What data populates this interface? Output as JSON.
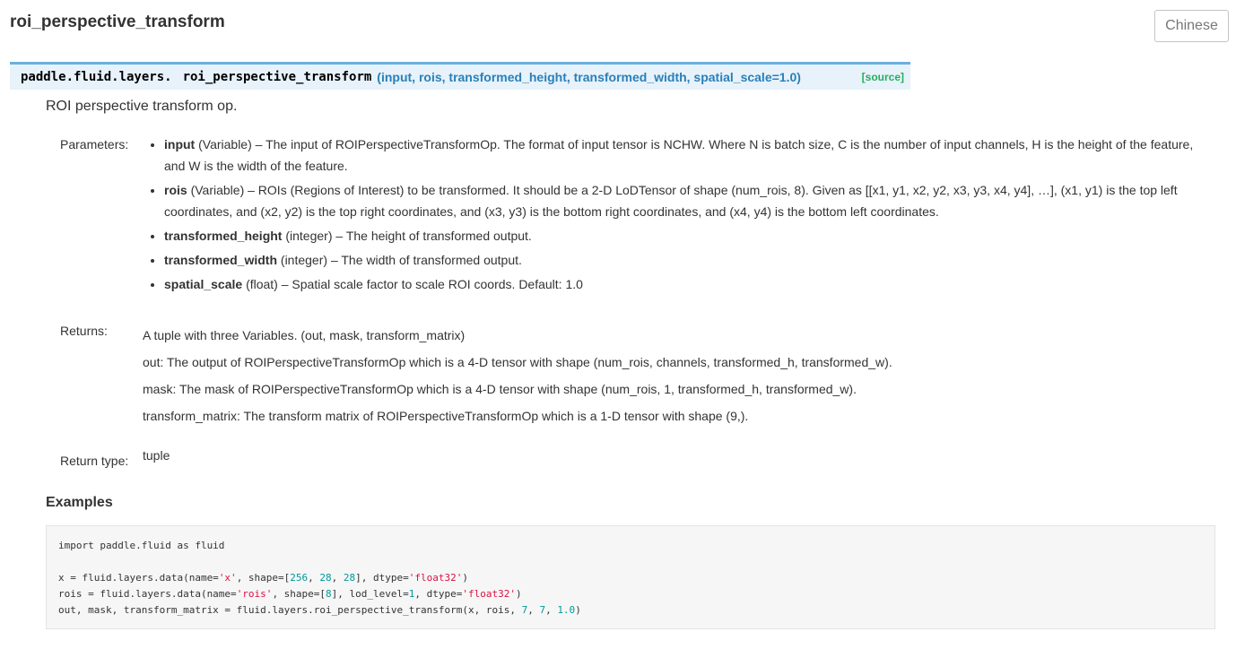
{
  "page": {
    "title": "roi_perspective_transform",
    "lang_button": "Chinese"
  },
  "signature": {
    "prefix": "paddle.fluid.layers.",
    "name": "roi_perspective_transform",
    "params": "(input, rois, transformed_height, transformed_width, spatial_scale=1.0)",
    "source": "[source]"
  },
  "description": "ROI perspective transform op.",
  "parameters": {
    "label": "Parameters:",
    "items": [
      {
        "name": "input",
        "type": "(Variable)",
        "desc": "– The input of ROIPerspectiveTransformOp. The format of input tensor is NCHW. Where N is batch size, C is the number of input channels, H is the height of the feature, and W is the width of the feature."
      },
      {
        "name": "rois",
        "type": "(Variable)",
        "desc": "– ROIs (Regions of Interest) to be transformed. It should be a 2-D LoDTensor of shape (num_rois, 8). Given as [[x1, y1, x2, y2, x3, y3, x4, y4], …], (x1, y1) is the top left coordinates, and (x2, y2) is the top right coordinates, and (x3, y3) is the bottom right coordinates, and (x4, y4) is the bottom left coordinates."
      },
      {
        "name": "transformed_height",
        "type": "(integer)",
        "desc": "– The height of transformed output."
      },
      {
        "name": "transformed_width",
        "type": "(integer)",
        "desc": "– The width of transformed output."
      },
      {
        "name": "spatial_scale",
        "type": "(float)",
        "desc": "– Spatial scale factor to scale ROI coords. Default: 1.0"
      }
    ]
  },
  "returns": {
    "label": "Returns:",
    "lines": [
      "A tuple with three Variables. (out, mask, transform_matrix)",
      "out: The output of ROIPerspectiveTransformOp which is a 4-D tensor with shape (num_rois, channels, transformed_h, transformed_w).",
      "mask: The mask of ROIPerspectiveTransformOp which is a 4-D tensor with shape (num_rois, 1, transformed_h, transformed_w).",
      "transform_matrix: The transform matrix of ROIPerspectiveTransformOp which is a 1-D tensor with shape (9,)."
    ]
  },
  "return_type": {
    "label": "Return type:",
    "value": "tuple"
  },
  "examples": {
    "title": "Examples",
    "code": {
      "import": "import paddle.fluid as fluid",
      "x_pre": "x = fluid.layers.data(name=",
      "x_name": "'x'",
      "x_mid": ", shape=[",
      "x_s1": "256",
      "x_s2": "28",
      "x_s3": "28",
      "x_mid2": "], dtype=",
      "x_dtype": "'float32'",
      "rois_pre": "rois = fluid.layers.data(name=",
      "rois_name": "'rois'",
      "rois_mid": ", shape=[",
      "rois_s1": "8",
      "rois_mid2": "], lod_level=",
      "rois_lod": "1",
      "rois_mid3": ", dtype=",
      "rois_dtype": "'float32'",
      "out_pre": "out, mask, transform_matrix = fluid.layers.roi_perspective_transform(x, rois, ",
      "out_a1": "7",
      "out_a2": "7",
      "out_a3": "1.0"
    }
  }
}
